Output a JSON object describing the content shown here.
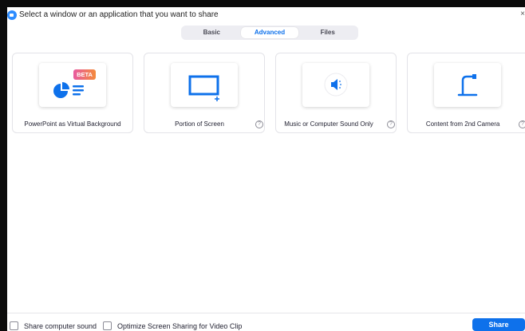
{
  "titlebar": {
    "title": "Select a window or an application that you want to share",
    "close_glyph": "×"
  },
  "tabs": [
    {
      "label": "Basic",
      "active": false
    },
    {
      "label": "Advanced",
      "active": true
    },
    {
      "label": "Files",
      "active": false
    }
  ],
  "cards": [
    {
      "label": "PowerPoint as Virtual Background",
      "badge": "BETA",
      "icon": "powerpoint-icon",
      "help": false
    },
    {
      "label": "Portion of Screen",
      "icon": "screen-portion-icon",
      "help": true
    },
    {
      "label": "Music or Computer Sound Only",
      "icon": "speaker-icon",
      "help": true
    },
    {
      "label": "Content from 2nd Camera",
      "icon": "document-camera-icon",
      "help": true
    }
  ],
  "help_glyph": "?",
  "footer": {
    "share_sound_label": "Share computer sound",
    "optimize_label": "Optimize Screen Sharing for Video Clip",
    "share_button": "Share"
  },
  "colors": {
    "accent": "#0e71eb",
    "badge_gradient": [
      "#f25b98",
      "#f9833a"
    ]
  }
}
